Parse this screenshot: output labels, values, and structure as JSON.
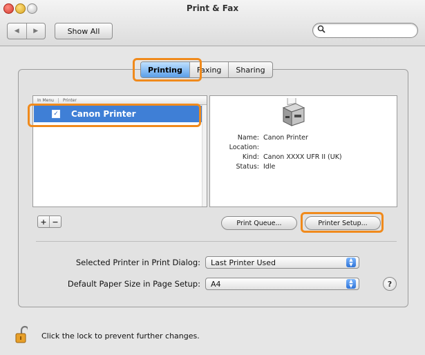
{
  "window": {
    "title": "Print & Fax",
    "show_all_label": "Show All",
    "nav_back": "◀",
    "nav_forward": "▶",
    "search_placeholder": ""
  },
  "tabs": [
    {
      "label": "Printing",
      "active": true
    },
    {
      "label": "Faxing",
      "active": false
    },
    {
      "label": "Sharing",
      "active": false
    }
  ],
  "printer_list": {
    "columns": [
      "In Menu",
      "Printer"
    ],
    "rows": [
      {
        "in_menu": true,
        "name": "Canon Printer",
        "selected": true
      }
    ],
    "add_label": "+",
    "remove_label": "−"
  },
  "printer_info": {
    "name_label": "Name:",
    "name_value": "Canon Printer",
    "location_label": "Location:",
    "location_value": "",
    "kind_label": "Kind:",
    "kind_value": "Canon XXXX UFR II (UK)",
    "status_label": "Status:",
    "status_value": "Idle"
  },
  "buttons": {
    "print_queue": "Print Queue...",
    "printer_setup": "Printer Setup..."
  },
  "prefs": {
    "selected_printer_label": "Selected Printer in Print Dialog:",
    "selected_printer_value": "Last Printer Used",
    "paper_size_label": "Default Paper Size in Page Setup:",
    "paper_size_value": "A4"
  },
  "help_label": "?",
  "lock_text": "Click the lock to prevent further changes.",
  "colors": {
    "highlight": "#f08a1c",
    "selection": "#3f7fd6"
  }
}
